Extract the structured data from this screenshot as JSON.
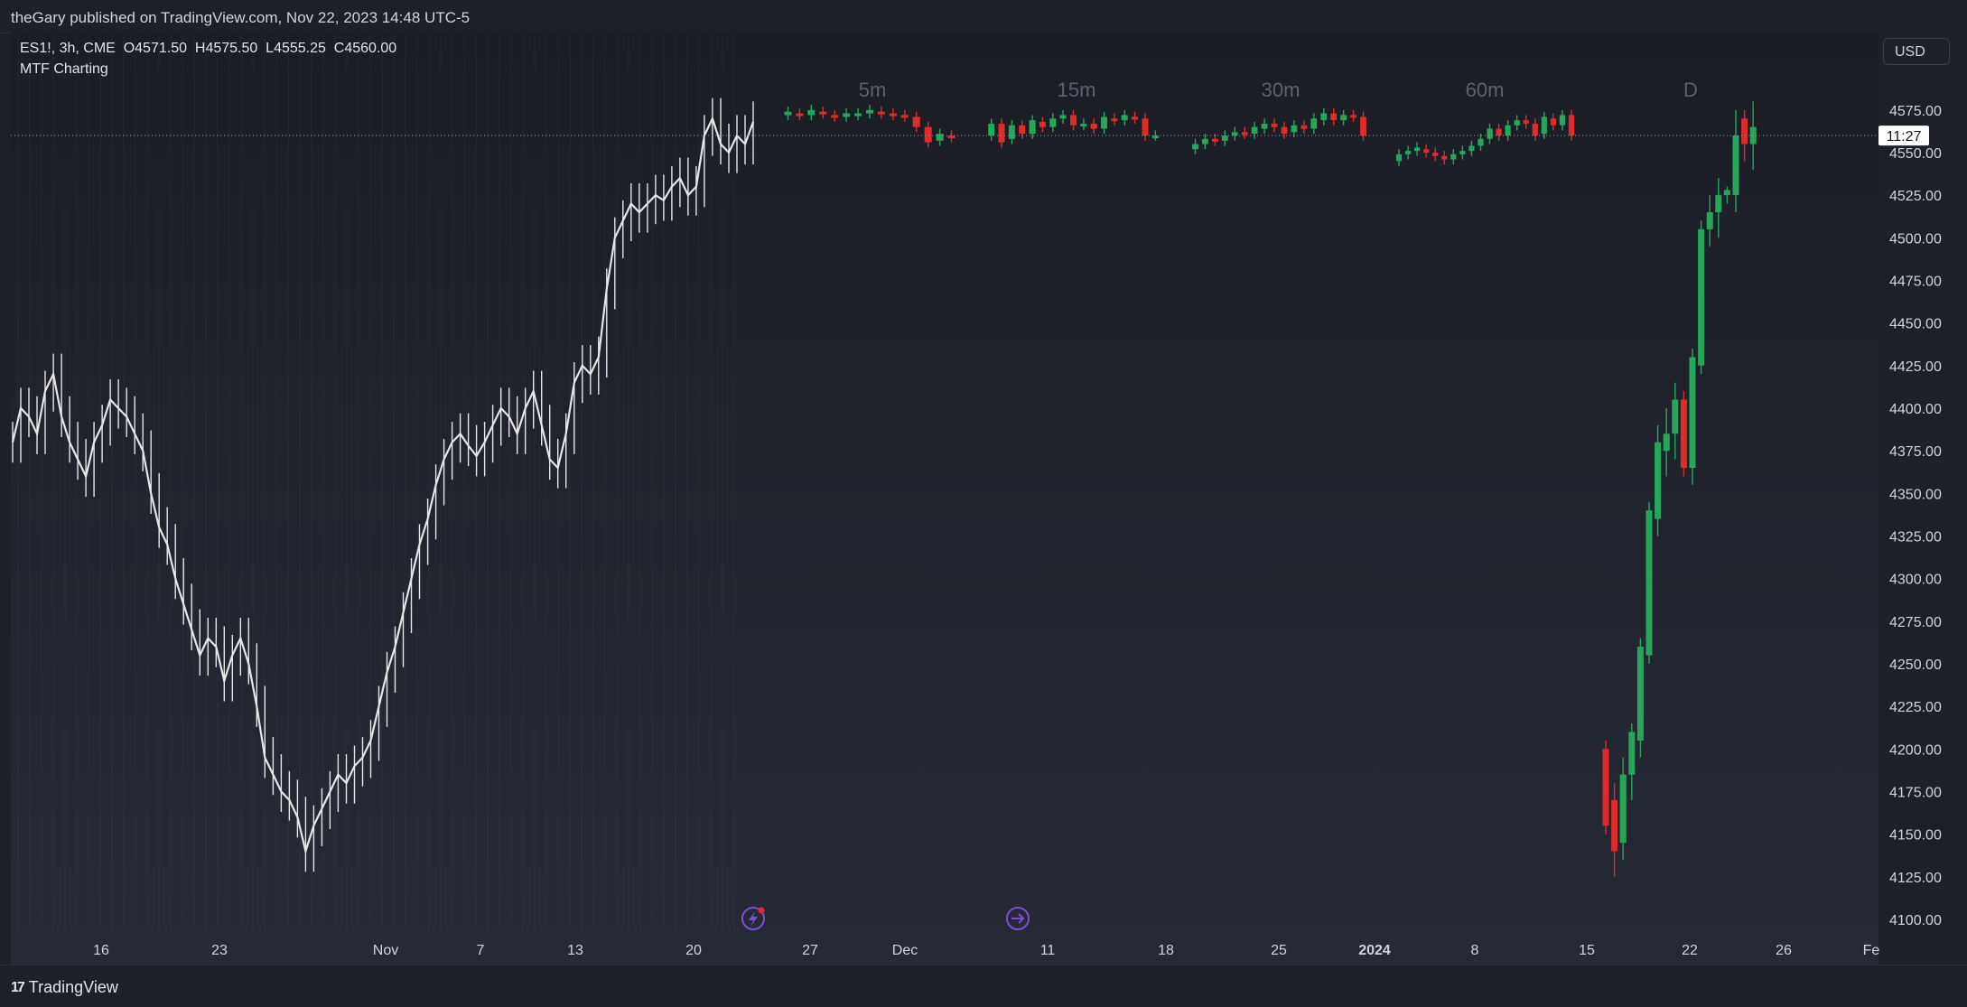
{
  "header": {
    "published_text": "theGary published on TradingView.com, Nov 22, 2023 14:48 UTC-5"
  },
  "legend": {
    "symbol_line": "ES1!, 3h, CME  O4571.50  H4575.50  L4555.25  C4560.00",
    "indicator_name": "MTF Charting"
  },
  "currency_button": "USD",
  "price_tag": {
    "price_label": "11:27",
    "price": 4560
  },
  "footer": {
    "logo_text": "TradingView"
  },
  "colors": {
    "up": "#26a65b",
    "down": "#e02b2b",
    "base_series": "#e6e6e6",
    "accent_icon": "#7b4fd6"
  },
  "chart_data": {
    "type": "candlestick",
    "symbol": "ES1!",
    "exchange": "CME",
    "timeframe": "3h",
    "ylim": [
      4100,
      4590
    ],
    "y_ticks": [
      "4100.00",
      "4125.00",
      "4150.00",
      "4175.00",
      "4200.00",
      "4225.00",
      "4250.00",
      "4275.00",
      "4300.00",
      "4325.00",
      "4350.00",
      "4375.00",
      "4400.00",
      "4425.00",
      "4450.00",
      "4475.00",
      "4500.00",
      "4525.00",
      "4550.00",
      "4575.00"
    ],
    "x_ticks": [
      "16",
      "23",
      "Nov",
      "7",
      "13",
      "20",
      "27",
      "Dec",
      "11",
      "18",
      "25",
      "2024",
      "8",
      "15",
      "22",
      "26",
      "Fe"
    ],
    "timeframe_panels": [
      "5m",
      "15m",
      "30m",
      "60m",
      "D"
    ],
    "base_series_closes": [
      4380,
      4400,
      4395,
      4385,
      4410,
      4420,
      4395,
      4380,
      4370,
      4360,
      4380,
      4390,
      4405,
      4400,
      4395,
      4385,
      4375,
      4350,
      4330,
      4320,
      4300,
      4285,
      4270,
      4255,
      4265,
      4260,
      4240,
      4255,
      4265,
      4250,
      4225,
      4195,
      4185,
      4175,
      4170,
      4160,
      4140,
      4155,
      4165,
      4175,
      4185,
      4180,
      4190,
      4195,
      4205,
      4225,
      4245,
      4260,
      4280,
      4300,
      4320,
      4335,
      4355,
      4370,
      4380,
      4385,
      4378,
      4372,
      4380,
      4390,
      4400,
      4395,
      4385,
      4400,
      4410,
      4390,
      4370,
      4365,
      4385,
      4415,
      4425,
      4420,
      4430,
      4470,
      4500,
      4510,
      4520,
      4515,
      4520,
      4525,
      4522,
      4530,
      4535,
      4525,
      4530,
      4560,
      4570,
      4555,
      4550,
      4560,
      4555,
      4568
    ],
    "mtf_5m": [
      [
        4572,
        4574
      ],
      [
        4573,
        4572
      ],
      [
        4572,
        4575
      ],
      [
        4574,
        4573
      ],
      [
        4572,
        4571
      ],
      [
        4571,
        4573
      ],
      [
        4572,
        4573
      ],
      [
        4573,
        4575
      ],
      [
        4574,
        4573
      ],
      [
        4573,
        4572
      ],
      [
        4572,
        4571
      ],
      [
        4571,
        4565
      ],
      [
        4565,
        4556
      ],
      [
        4557,
        4561
      ],
      [
        4560,
        4559
      ]
    ],
    "mtf_15m": [
      [
        4560,
        4567
      ],
      [
        4567,
        4556
      ],
      [
        4558,
        4566
      ],
      [
        4566,
        4561
      ],
      [
        4561,
        4569
      ],
      [
        4568,
        4565
      ],
      [
        4565,
        4570
      ],
      [
        4570,
        4572
      ],
      [
        4572,
        4566
      ],
      [
        4566,
        4567
      ],
      [
        4567,
        4564
      ],
      [
        4564,
        4571
      ],
      [
        4570,
        4569
      ],
      [
        4569,
        4572
      ],
      [
        4571,
        4570
      ],
      [
        4570,
        4560
      ],
      [
        4560,
        4560
      ]
    ],
    "mtf_30m": [
      [
        4552,
        4555
      ],
      [
        4555,
        4558
      ],
      [
        4558,
        4557
      ],
      [
        4557,
        4560
      ],
      [
        4560,
        4562
      ],
      [
        4562,
        4561
      ],
      [
        4561,
        4565
      ],
      [
        4564,
        4567
      ],
      [
        4567,
        4565
      ],
      [
        4565,
        4561
      ],
      [
        4562,
        4566
      ],
      [
        4566,
        4564
      ],
      [
        4564,
        4570
      ],
      [
        4569,
        4573
      ],
      [
        4573,
        4569
      ],
      [
        4569,
        4572
      ],
      [
        4572,
        4571
      ],
      [
        4571,
        4560
      ]
    ],
    "mtf_60m": [
      [
        4545,
        4549
      ],
      [
        4549,
        4551
      ],
      [
        4551,
        4553
      ],
      [
        4552,
        4550
      ],
      [
        4550,
        4548
      ],
      [
        4548,
        4546
      ],
      [
        4546,
        4549
      ],
      [
        4549,
        4551
      ],
      [
        4551,
        4554
      ],
      [
        4554,
        4558
      ],
      [
        4558,
        4564
      ],
      [
        4564,
        4560
      ],
      [
        4560,
        4566
      ],
      [
        4566,
        4569
      ],
      [
        4569,
        4567
      ],
      [
        4567,
        4560
      ],
      [
        4561,
        4571
      ],
      [
        4570,
        4566
      ],
      [
        4566,
        4572
      ],
      [
        4572,
        4560
      ]
    ],
    "daily": [
      {
        "o": 4200,
        "h": 4205,
        "l": 4150,
        "c": 4155
      },
      {
        "o": 4170,
        "h": 4180,
        "l": 4125,
        "c": 4140
      },
      {
        "o": 4145,
        "h": 4195,
        "l": 4135,
        "c": 4185
      },
      {
        "o": 4185,
        "h": 4215,
        "l": 4170,
        "c": 4210
      },
      {
        "o": 4205,
        "h": 4265,
        "l": 4195,
        "c": 4260
      },
      {
        "o": 4255,
        "h": 4345,
        "l": 4250,
        "c": 4340
      },
      {
        "o": 4335,
        "h": 4390,
        "l": 4325,
        "c": 4380
      },
      {
        "o": 4375,
        "h": 4400,
        "l": 4360,
        "c": 4385
      },
      {
        "o": 4385,
        "h": 4415,
        "l": 4370,
        "c": 4405
      },
      {
        "o": 4405,
        "h": 4410,
        "l": 4360,
        "c": 4365
      },
      {
        "o": 4365,
        "h": 4435,
        "l": 4355,
        "c": 4430
      },
      {
        "o": 4425,
        "h": 4510,
        "l": 4420,
        "c": 4505
      },
      {
        "o": 4505,
        "h": 4525,
        "l": 4495,
        "c": 4515
      },
      {
        "o": 4515,
        "h": 4535,
        "l": 4500,
        "c": 4525
      },
      {
        "o": 4525,
        "h": 4530,
        "l": 4520,
        "c": 4528
      },
      {
        "o": 4525,
        "h": 4575,
        "l": 4515,
        "c": 4560
      },
      {
        "o": 4570,
        "h": 4575,
        "l": 4545,
        "c": 4555
      },
      {
        "o": 4555,
        "h": 4580,
        "l": 4540,
        "c": 4565
      }
    ]
  }
}
